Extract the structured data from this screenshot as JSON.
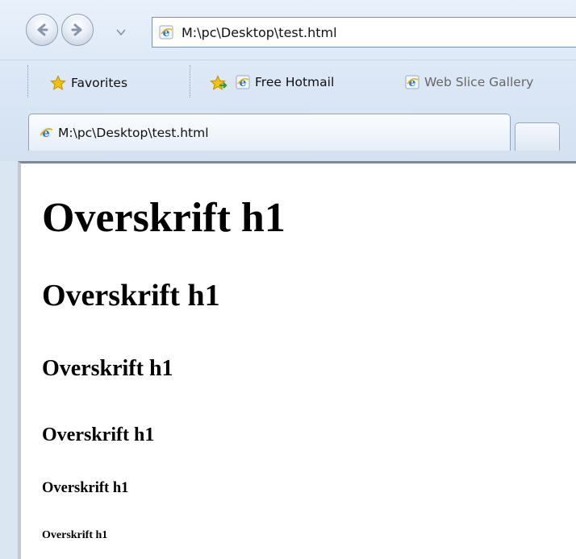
{
  "browser": {
    "address": "M:\\pc\\Desktop\\test.html",
    "favorites_label": "Favorites",
    "links": [
      {
        "label": "Free Hotmail"
      },
      {
        "label": "Web Slice Gallery"
      }
    ],
    "tab_title": "M:\\pc\\Desktop\\test.html"
  },
  "page": {
    "headings": [
      "Overskrift h1",
      "Overskrift h1",
      "Overskrift h1",
      "Overskrift h1",
      "Overskrift h1",
      "Overskrift h1"
    ]
  },
  "colors": {
    "chrome_bg": "#dce8f6",
    "page_bg": "#ffffff",
    "ie_icon_blue": "#2a7ad6"
  },
  "icons": {
    "back": "back-arrow-icon",
    "forward": "forward-arrow-icon",
    "favorites": "star-icon",
    "add_favorite": "add-to-favorites-icon",
    "ie": "ie-logo-icon"
  }
}
